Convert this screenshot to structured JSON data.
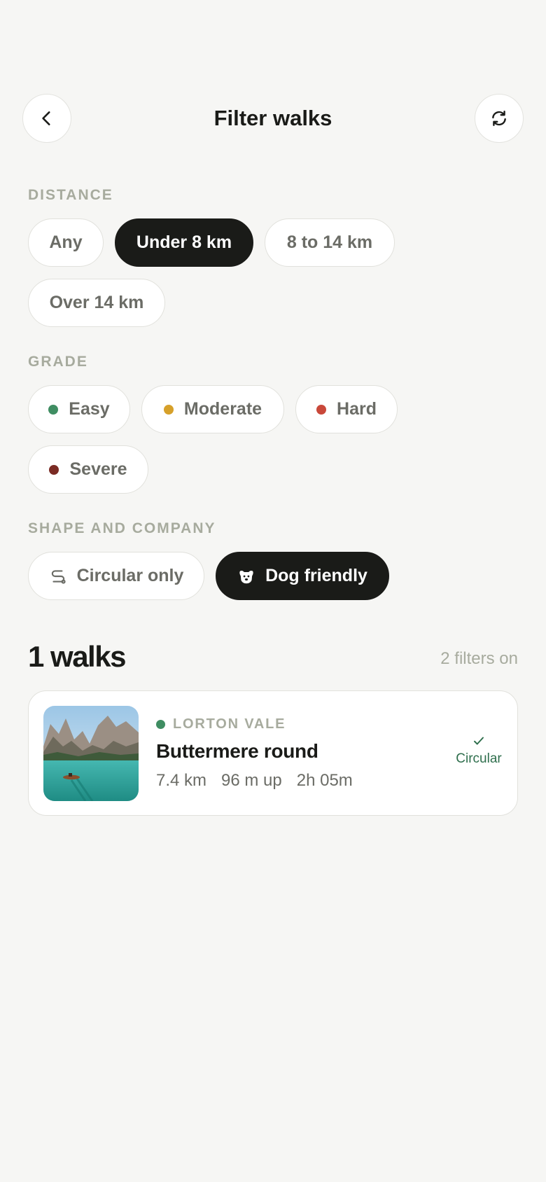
{
  "header": {
    "title": "Filter walks"
  },
  "distance": {
    "label": "DISTANCE",
    "options": [
      "Any",
      "Under 8 km",
      "8 to 14 km",
      "Over 14 km"
    ],
    "selected": "Under 8 km"
  },
  "grade": {
    "label": "GRADE",
    "options": [
      {
        "label": "Easy",
        "color": "#3f8d62"
      },
      {
        "label": "Moderate",
        "color": "#d6a02a"
      },
      {
        "label": "Hard",
        "color": "#c9483a"
      },
      {
        "label": "Severe",
        "color": "#7a2b24"
      }
    ]
  },
  "shape": {
    "label": "SHAPE AND COMPANY",
    "options": [
      {
        "label": "Circular only",
        "icon": "route-icon",
        "selected": false
      },
      {
        "label": "Dog friendly",
        "icon": "dog-icon",
        "selected": true
      }
    ]
  },
  "results": {
    "count_text": "1 walks",
    "filters_text": "2 filters on"
  },
  "walks": [
    {
      "location": "LORTON VALE",
      "name": "Buttermere round",
      "distance": "7.4 km",
      "ascent": "96 m up",
      "duration": "2h 05m",
      "badge": "Circular",
      "grade_color": "#3f8d62"
    }
  ],
  "colors": {
    "background": "#f6f6f4",
    "selected_chip": "#1a1b18",
    "accent_green": "#2f6f4d"
  }
}
